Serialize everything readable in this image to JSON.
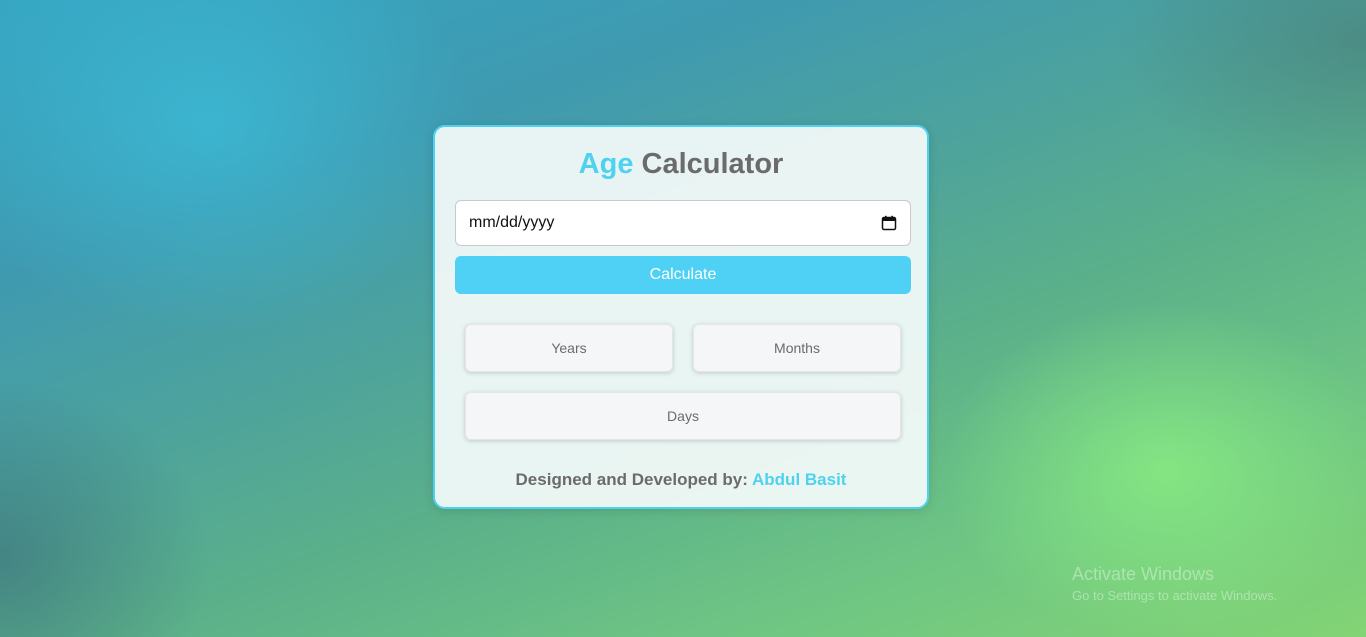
{
  "card": {
    "title_accent": "Age",
    "title_rest": "Calculator",
    "date_input": {
      "placeholder": "mm/dd/yyyy",
      "icon": "calendar-icon"
    },
    "calculate_label": "Calculate",
    "results": {
      "years_label": "Years",
      "months_label": "Months",
      "days_label": "Days"
    },
    "footer": {
      "prefix": "Designed and Developed by:",
      "author": "Abdul Basit"
    }
  },
  "watermark": {
    "title": "Activate Windows",
    "subtitle": "Go to Settings to activate Windows."
  },
  "colors": {
    "accent": "#4fd1f0",
    "button": "#4fd1f6",
    "text": "#6b6b6b"
  }
}
